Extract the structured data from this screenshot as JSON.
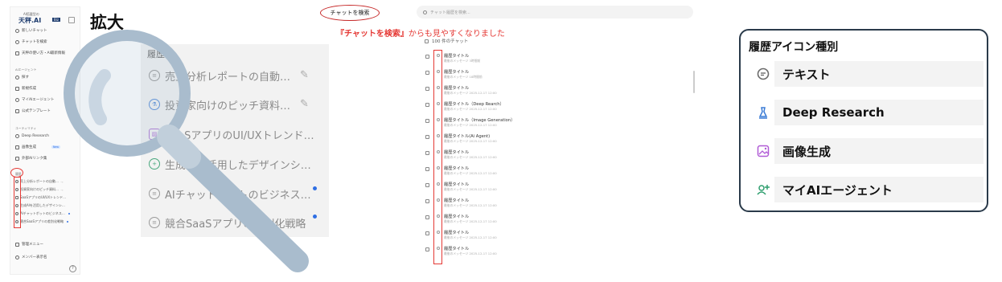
{
  "sidebar": {
    "logo_small": "AI搭載型の",
    "logo_main": "天秤.AI",
    "logo_badge": "Biz",
    "items": [
      {
        "label": "新しいチャット"
      },
      {
        "label": "チャットを検索"
      },
      {
        "label": "天秤の使い方・AI最新情報"
      }
    ],
    "section_agent": "AIエージェント",
    "agent_items": [
      {
        "label": "探す"
      },
      {
        "label": "新規作成"
      },
      {
        "label": "マイAIエージェント"
      },
      {
        "label": "公式テンプレート"
      }
    ],
    "section_utility": "ユーティリティ",
    "utility_items": [
      {
        "label": "Deep Research"
      },
      {
        "label": "画像生成",
        "badge": "New"
      },
      {
        "label": "外部AIリンク集"
      }
    ],
    "section_history": "履歴",
    "history": [
      "売上分析レポートの自動…",
      "投資家向けのピッチ資料…",
      "SaaSアプリのUI/UXトレンド…",
      "生成AIを活用したデザインシ…",
      "AIチャットボットのビジネス…",
      "競合SaaSアプリの差別化戦略"
    ],
    "bottom_items": [
      {
        "label": "管理メニュー"
      },
      {
        "label": "メンバー表示名"
      }
    ],
    "help_icon": "?"
  },
  "zoom": {
    "label": "拡大",
    "panel_header": "履歴",
    "items": [
      {
        "label": "売上分析レポートの自動…",
        "icon": "chat-icon",
        "pinned": true,
        "dot": false
      },
      {
        "label": "投資家向けのピッチ資料…",
        "icon": "deep-research-icon",
        "pinned": true,
        "dot": false
      },
      {
        "label": "SaaSアプリのUI/UXトレンド…",
        "icon": "image-icon",
        "pinned": false,
        "dot": false
      },
      {
        "label": "生成AIを活用したデザインシ…",
        "icon": "agent-icon",
        "pinned": false,
        "dot": false
      },
      {
        "label": "AIチャットボットのビジネス…",
        "icon": "chat-icon",
        "pinned": false,
        "dot": true
      },
      {
        "label": "競合SaaSアプリの差別化戦略",
        "icon": "chat-icon",
        "pinned": false,
        "dot": true
      }
    ]
  },
  "search_page": {
    "callout": "チャットを検索",
    "note_bold": "『チャットを検索』",
    "note_rest": "からも見やすくなりました",
    "search_placeholder": "チャット履歴を検索...",
    "count_label": "100 件のチャット",
    "rows": [
      {
        "title": "履歴タイトル",
        "sub": "最後のメッセージ 3時間前"
      },
      {
        "title": "履歴タイトル",
        "sub": "最後のメッセージ 18時間前"
      },
      {
        "title": "履歴タイトル",
        "sub": "最後のメッセージ 2025-12-17 12:00"
      },
      {
        "title": "履歴タイトル（Deep Rearch）",
        "sub": "最後のメッセージ 2025-12-17 12:00"
      },
      {
        "title": "履歴タイトル（Image Generation）",
        "sub": "最後のメッセージ 2025-12-17 12:00"
      },
      {
        "title": "履歴タイトル(Ai Agent)",
        "sub": "最後のメッセージ 2025-12-17 12:00"
      },
      {
        "title": "履歴タイトル",
        "sub": "最後のメッセージ 2025-12-17 12:00"
      },
      {
        "title": "履歴タイトル",
        "sub": "最後のメッセージ 2025-12-17 12:00"
      },
      {
        "title": "履歴タイトル",
        "sub": "最後のメッセージ 2025-12-17 12:00"
      },
      {
        "title": "履歴タイトル",
        "sub": "最後のメッセージ 2025-12-17 12:00"
      },
      {
        "title": "履歴タイトル",
        "sub": "最後のメッセージ 2025-12-17 12:00"
      },
      {
        "title": "履歴タイトル",
        "sub": "最後のメッセージ 2025-12-17 12:00"
      },
      {
        "title": "履歴タイトル",
        "sub": "最後のメッセージ 2025-12-17 12:00"
      }
    ]
  },
  "legend": {
    "title": "履歴アイコン種別",
    "items": [
      {
        "label": "テキスト",
        "icon": "chat-icon",
        "color": "#6b6b6b"
      },
      {
        "label": "Deep Research",
        "icon": "deep-research-icon",
        "color": "#3a7bd5"
      },
      {
        "label": "画像生成",
        "icon": "image-icon",
        "color": "#b05ad6"
      },
      {
        "label": "マイAIエージェント",
        "icon": "agent-icon",
        "color": "#2e9e6e"
      }
    ]
  },
  "colors": {
    "accent_red": "#e53935",
    "unread_dot": "#2f6fe4",
    "logo_navy": "#1e3c6e"
  }
}
